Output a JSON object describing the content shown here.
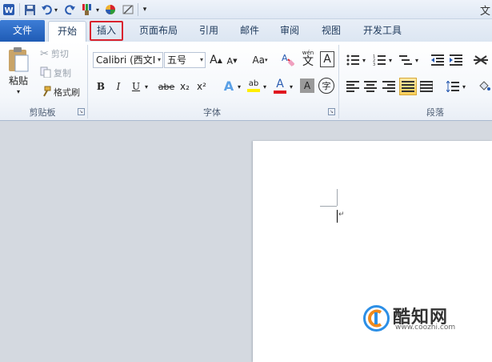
{
  "window": {
    "title_partial": "文"
  },
  "quick_access": {
    "customize_label": "▾"
  },
  "tabs": [
    {
      "label": "文件"
    },
    {
      "label": "开始"
    },
    {
      "label": "插入"
    },
    {
      "label": "页面布局"
    },
    {
      "label": "引用"
    },
    {
      "label": "邮件"
    },
    {
      "label": "审阅"
    },
    {
      "label": "视图"
    },
    {
      "label": "开发工具"
    }
  ],
  "clipboard": {
    "paste_label": "粘贴",
    "cut_label": "剪切",
    "copy_label": "复制",
    "format_painter_label": "格式刷",
    "group_label": "剪贴板"
  },
  "font": {
    "font_name": "Calibri (西文I",
    "font_size": "五号",
    "grow_label": "A",
    "shrink_label": "A",
    "case_label": "Aa",
    "phonetic_label": "wén",
    "char_border_label": "A",
    "bold_label": "B",
    "italic_label": "I",
    "underline_label": "U",
    "strike_label": "abe",
    "subscript_label": "x₂",
    "superscript_label": "x²",
    "effects_label": "A",
    "highlight_label": "ab",
    "color_label": "A",
    "shading_label": "A",
    "enclose_label": "字",
    "group_label": "字体"
  },
  "paragraph": {
    "group_label": "段落"
  },
  "colors": {
    "highlight": "#d9232e",
    "file_tab": "#2a64c1",
    "watermark_blue": "#2c8fe6",
    "watermark_orange": "#f08a1c"
  },
  "watermark": {
    "name": "酷知网",
    "url": "www.coozhi.com"
  }
}
